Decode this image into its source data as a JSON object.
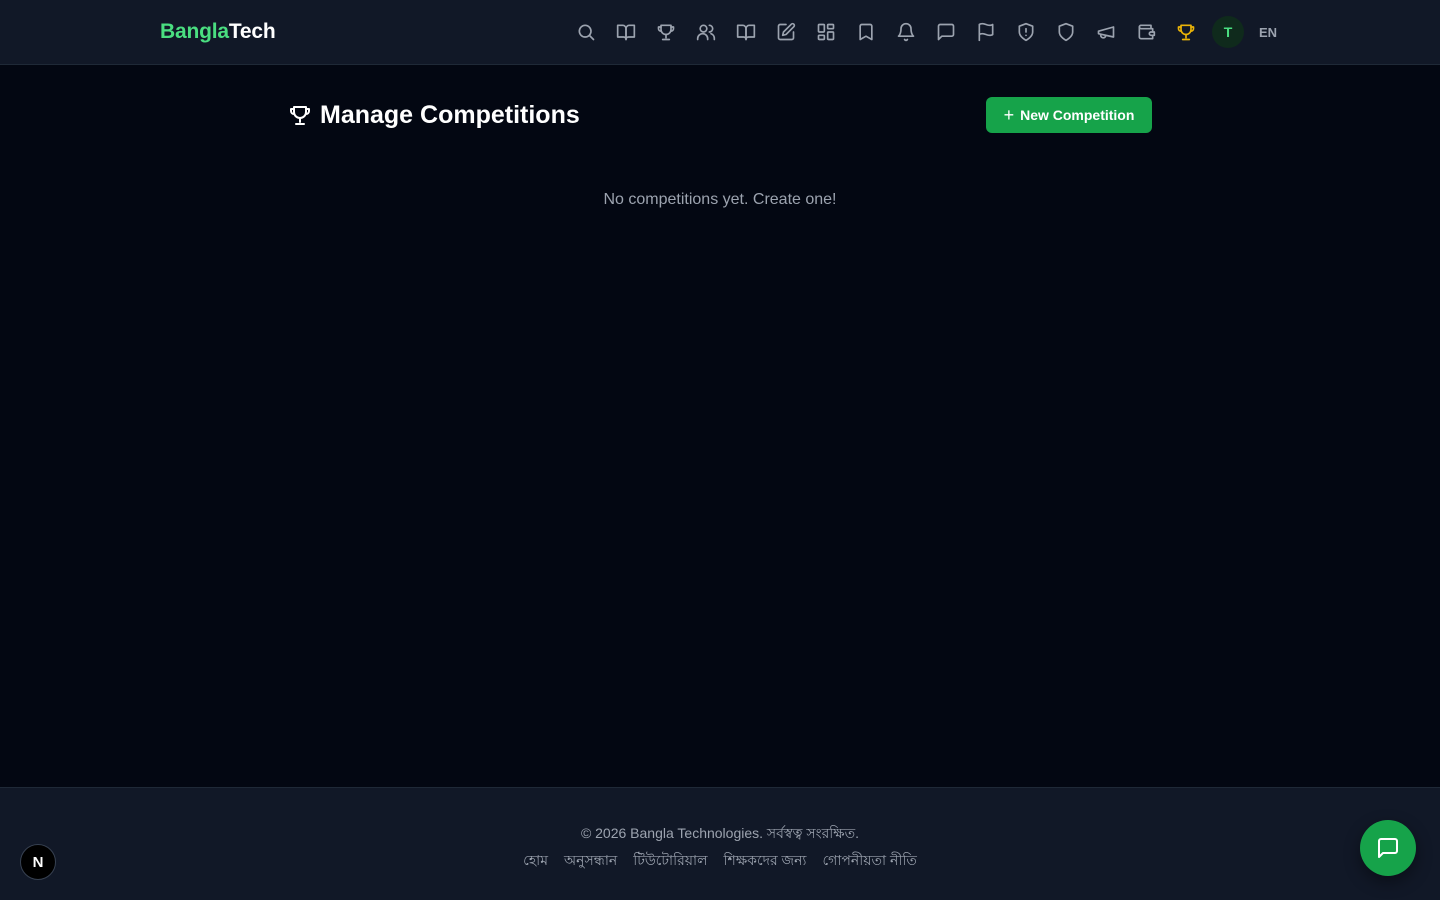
{
  "brand": {
    "part1": "Bangla",
    "part2": "Tech"
  },
  "nav": {
    "icons": [
      "search-icon",
      "book-open-icon",
      "trophy-icon",
      "users-icon",
      "book-open-icon",
      "edit-icon",
      "grid-icon",
      "bookmark-icon",
      "bell-icon",
      "message-icon",
      "flag-icon",
      "shield-alert-icon",
      "shield-icon",
      "megaphone-icon",
      "wallet-icon",
      "trophy-icon"
    ],
    "active_icon": "trophy-icon",
    "active_color": "#eab308",
    "avatar_initial": "T",
    "language": "EN"
  },
  "main": {
    "title": "Manage Competitions",
    "new_button_label": "New Competition",
    "empty_message": "No competitions yet. Create one!"
  },
  "footer": {
    "copyright": "© 2026 Bangla Technologies. সর্বস্বত্ব সংরক্ষিত.",
    "links": [
      "হোম",
      "অনুসন্ধান",
      "টিউটোরিয়াল",
      "শিক্ষকদের জন্য",
      "গোপনীয়তা নীতি"
    ]
  },
  "next_badge": "N",
  "colors": {
    "accent": "#16a34a",
    "brand_green": "#4ade80",
    "background": "#030712",
    "header": "#111827"
  }
}
